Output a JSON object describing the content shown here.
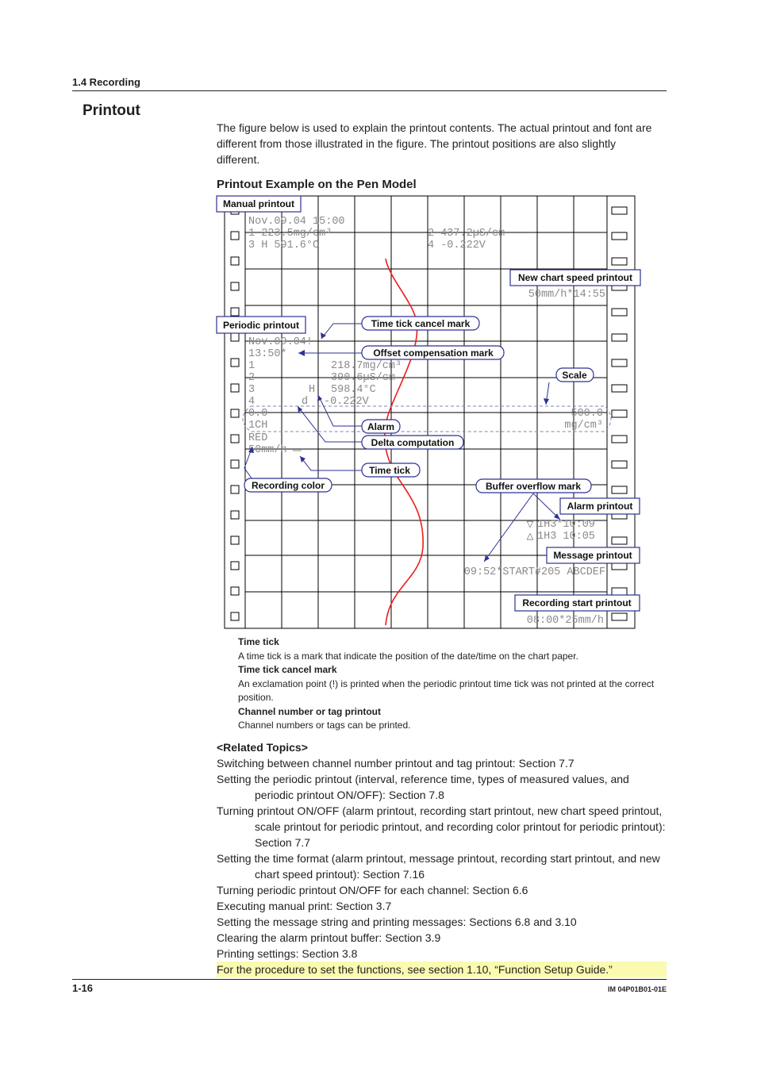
{
  "header": {
    "section": "1.4  Recording"
  },
  "page_title": "Printout",
  "intro": "The figure below is used to explain the printout contents. The actual printout and font are different from those illustrated in the figure. The printout positions are also slightly different.",
  "figure": {
    "title": "Printout Example on the Pen Model",
    "manual_printout": {
      "line1": "Nov.09.04 15:00",
      "line2a": "1    223.5mg/cm³",
      "line3a": "3 H  591.6°C",
      "line2b": "2    437.2µS/cm",
      "line3b": "4   -0.222V"
    },
    "new_chart_speed": "50mm/h*14:55",
    "periodic_printout": {
      "date": "Nov.09.04!",
      "time": "13:50*",
      "rows": [
        {
          "ch": "1",
          "flag": "",
          "value": "218.7mg/cm³"
        },
        {
          "ch": "2",
          "flag": "",
          "value": "390.6µS/cm"
        },
        {
          "ch": "3",
          "flag": "H",
          "value": "598.4°C"
        },
        {
          "ch": "4",
          "flag": "d",
          "value": "-0.222V"
        }
      ],
      "scale_low": "0.0",
      "scale_ch": "1CH",
      "scale_high": "500.0",
      "scale_unit": "mg/cm³",
      "color": "RED",
      "speed": "50mm/h"
    },
    "alarm_printout": {
      "line1": "1H3*10:09",
      "line2": "1H3 10:05"
    },
    "message_printout": "09:52*START#205 ABCDEF",
    "recording_start": "08:00*25mm/h",
    "callouts": {
      "manual_printout": "Manual printout",
      "new_chart_speed_printout": "New chart speed printout",
      "periodic_printout": "Periodic printout",
      "time_tick_cancel_mark": "Time tick cancel mark",
      "offset_compensation_mark": "Offset compensation mark",
      "scale": "Scale",
      "alarm": "Alarm",
      "delta_computation": "Delta computation",
      "time_tick": "Time tick",
      "recording_color": "Recording color",
      "buffer_overflow_mark": "Buffer overflow mark",
      "alarm_printout": "Alarm printout",
      "message_printout": "Message printout",
      "recording_start_printout": "Recording start printout"
    },
    "colors": {
      "trace": "#ee1c1c",
      "callout_border": "#2e3192",
      "printout_text": "#8a8a8a",
      "grid": "#000000",
      "scale_outline": "#8080c0"
    }
  },
  "notes": [
    {
      "term": "Time tick",
      "desc": "A time tick is a mark that indicate the position of the date/time on the chart paper."
    },
    {
      "term": "Time tick cancel mark",
      "desc": "An exclamation point (!) is printed when the periodic printout time tick was not printed at the correct position."
    },
    {
      "term": "Channel number or tag printout",
      "desc": "Channel numbers or tags can be printed."
    }
  ],
  "related": {
    "heading": "<Related Topics>",
    "items": [
      "Switching between channel number printout and tag printout: Section 7.7",
      "Setting the periodic printout (interval, reference time, types of measured values, and periodic printout ON/OFF): Section 7.8",
      "Turning printout ON/OFF (alarm printout, recording start printout, new chart speed printout, scale printout for periodic printout, and recording color printout for periodic printout): Section 7.7",
      "Setting the time format (alarm printout, message printout, recording start printout, and new chart speed printout): Section 7.16",
      "Turning periodic printout ON/OFF for each channel: Section 6.6",
      "Executing manual print: Section 3.7",
      "Setting the message string and printing messages: Sections 6.8 and 3.10",
      "Clearing the alarm printout buffer: Section 3.9",
      "Printing settings: Section 3.8"
    ],
    "highlight": "For the procedure to set the functions, see section 1.10, “Function Setup Guide.”"
  },
  "footer": {
    "page": "1-16",
    "doc_id": "IM 04P01B01-01E"
  }
}
